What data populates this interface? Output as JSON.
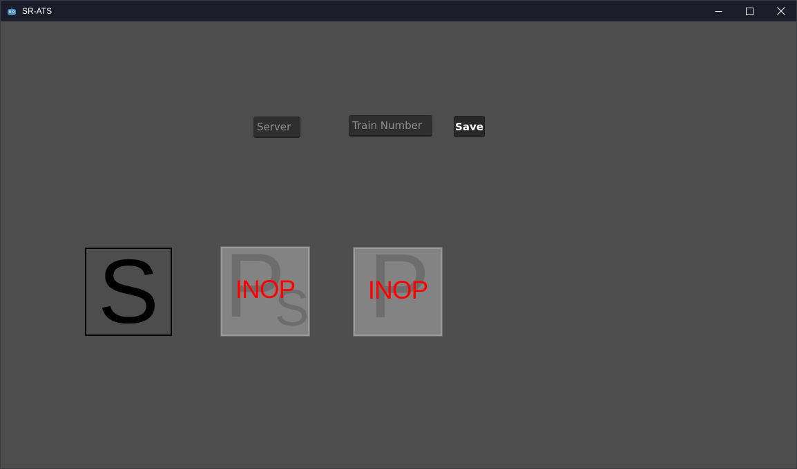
{
  "window": {
    "title": "SR-ATS",
    "icons": {
      "app": "app-icon",
      "minimize": "minimize-icon",
      "maximize": "maximize-icon",
      "close": "close-icon"
    }
  },
  "form": {
    "server": {
      "placeholder": "Server",
      "value": ""
    },
    "train_number": {
      "placeholder": "Train Number",
      "value": ""
    },
    "save_label": "Save"
  },
  "indicators": [
    {
      "id": "s",
      "letter": "S",
      "state": "active",
      "color": "#000000"
    },
    {
      "id": "ps",
      "letter": "P",
      "subscript": "S",
      "status": "INOP",
      "state": "inop"
    },
    {
      "id": "p",
      "letter": "P",
      "status": "INOP",
      "state": "inop"
    }
  ],
  "colors": {
    "background": "#4d4d4d",
    "titlebar": "#1b1d2b",
    "inop_text": "#ff0000",
    "inop_box": "#838383"
  }
}
